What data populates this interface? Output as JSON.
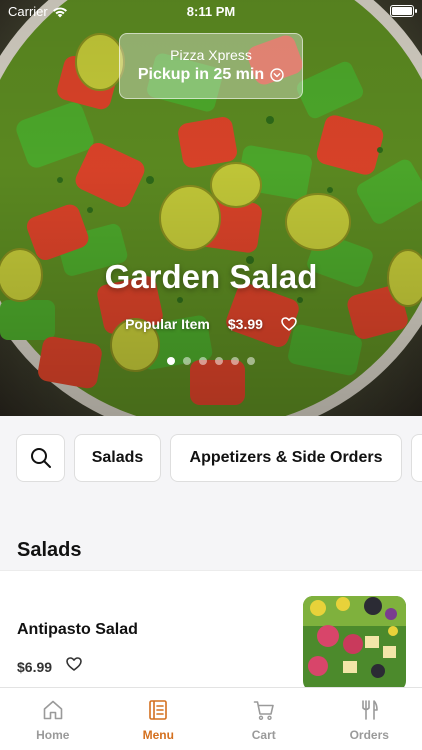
{
  "status_bar": {
    "carrier": "Carrier",
    "time": "8:11 PM"
  },
  "hero": {
    "store_name": "Pizza Xpress",
    "pickup_text": "Pickup in 25 min",
    "title": "Garden Salad",
    "tag": "Popular Item",
    "price": "$3.99",
    "carousel_pages": 6,
    "carousel_active_index": 0
  },
  "categories": [
    {
      "label": "Salads"
    },
    {
      "label": "Appetizers & Side Orders"
    }
  ],
  "section": {
    "title": "Salads"
  },
  "items": [
    {
      "name": "Antipasto Salad",
      "price": "$6.99"
    }
  ],
  "tabs": [
    {
      "label": "Home",
      "icon": "home-icon"
    },
    {
      "label": "Menu",
      "icon": "menu-book-icon",
      "active": true
    },
    {
      "label": "Cart",
      "icon": "cart-icon"
    },
    {
      "label": "Orders",
      "icon": "cutlery-icon"
    }
  ],
  "colors": {
    "accent": "#d4701f",
    "inactive_tab": "#9a9a9a"
  }
}
